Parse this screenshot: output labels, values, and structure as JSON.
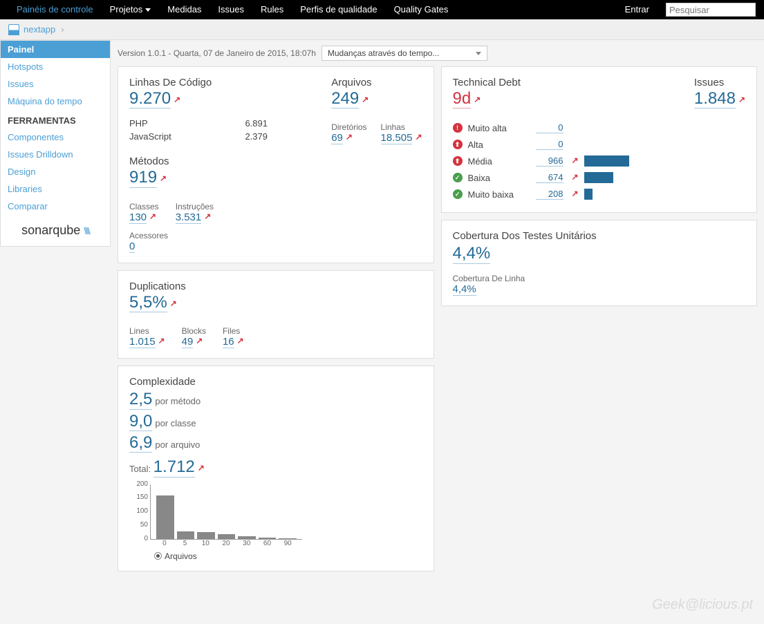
{
  "topnav": {
    "items": [
      {
        "label": "Painéis de controle",
        "active": true
      },
      {
        "label": "Projetos",
        "dropdown": true
      },
      {
        "label": "Medidas"
      },
      {
        "label": "Issues"
      },
      {
        "label": "Rules"
      },
      {
        "label": "Perfis de qualidade"
      },
      {
        "label": "Quality Gates"
      }
    ],
    "login": "Entrar",
    "search_placeholder": "Pesquisar"
  },
  "breadcrumb": {
    "project": "nextapp"
  },
  "sidebar": {
    "items": [
      {
        "label": "Painel",
        "active": true
      },
      {
        "label": "Hotspots"
      },
      {
        "label": "Issues"
      },
      {
        "label": "Máquina do tempo"
      }
    ],
    "tools_header": "FERRAMENTAS",
    "tools": [
      {
        "label": "Componentes"
      },
      {
        "label": "Issues Drilldown"
      },
      {
        "label": "Design"
      },
      {
        "label": "Libraries"
      },
      {
        "label": "Comparar"
      }
    ],
    "logo": "sonarqube"
  },
  "meta": {
    "version_text": "Version 1.0.1 - Quarta, 07 de Janeiro de 2015, 18:07h",
    "time_dropdown": "Mudanças através do tempo..."
  },
  "loc": {
    "title": "Linhas De Código",
    "value": "9.270",
    "langs": [
      {
        "name": "PHP",
        "val": "6.891"
      },
      {
        "name": "JavaScript",
        "val": "2.379"
      }
    ],
    "files_title": "Arquivos",
    "files": "249",
    "dirs_title": "Diretórios",
    "dirs": "69",
    "lines_title": "Linhas",
    "lines": "18.505",
    "methods_title": "Métodos",
    "methods": "919",
    "classes_title": "Classes",
    "classes": "130",
    "stmts_title": "Instruções",
    "stmts": "3.531",
    "accessors_title": "Acessores",
    "accessors": "0"
  },
  "dup": {
    "title": "Duplications",
    "value": "5,5%",
    "lines_title": "Lines",
    "lines": "1.015",
    "blocks_title": "Blocks",
    "blocks": "49",
    "files_title": "Files",
    "files": "16"
  },
  "cplx": {
    "title": "Complexidade",
    "per_method": "2,5",
    "per_method_label": "por método",
    "per_class": "9,0",
    "per_class_label": "por classe",
    "per_file": "6,9",
    "per_file_label": "por arquivo",
    "total_label": "Total:",
    "total": "1.712",
    "legend": "Arquivos"
  },
  "debt": {
    "title": "Technical Debt",
    "value": "9d",
    "issues_title": "Issues",
    "issues": "1.848",
    "severities": [
      {
        "icon": "sev-blocker",
        "glyph": "!",
        "label": "Muito alta",
        "count": "0",
        "bar": 0,
        "arrow": false
      },
      {
        "icon": "sev-critical",
        "glyph": "⬆",
        "label": "Alta",
        "count": "0",
        "bar": 0,
        "arrow": false
      },
      {
        "icon": "sev-major",
        "glyph": "⬆",
        "label": "Média",
        "count": "966",
        "bar": 65,
        "arrow": true
      },
      {
        "icon": "sev-minor",
        "glyph": "✓",
        "label": "Baixa",
        "count": "674",
        "bar": 42,
        "arrow": true
      },
      {
        "icon": "sev-info",
        "glyph": "✓",
        "label": "Muito baixa",
        "count": "208",
        "bar": 12,
        "arrow": true
      }
    ]
  },
  "coverage": {
    "title": "Cobertura Dos Testes Unitários",
    "value": "4,4%",
    "line_title": "Cobertura De Linha",
    "line_value": "4,4%"
  },
  "chart_data": {
    "type": "bar",
    "categories": [
      "0",
      "5",
      "10",
      "20",
      "30",
      "60",
      "90"
    ],
    "values": [
      160,
      28,
      25,
      18,
      10,
      5,
      2
    ],
    "ylim": [
      0,
      200
    ],
    "yticks": [
      "200",
      "150",
      "100",
      "50",
      "0"
    ],
    "xlabel": "",
    "ylabel": "",
    "legend": "Arquivos"
  },
  "watermark": "Geek@licious.pt"
}
